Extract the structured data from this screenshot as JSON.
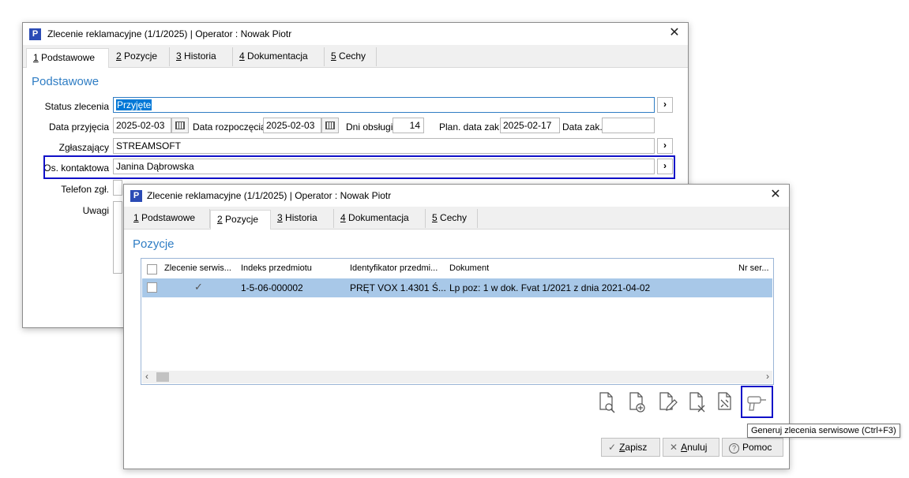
{
  "back_window": {
    "title": "Zlecenie reklamacyjne (1/1/2025)  |  Operator : Nowak Piotr",
    "app_icon_letter": "P",
    "close_glyph": "✕",
    "tabs": [
      {
        "key": "1",
        "label": " Podstawowe"
      },
      {
        "key": "2",
        "label": " Pozycje"
      },
      {
        "key": "3",
        "label": " Historia"
      },
      {
        "key": "4",
        "label": " Dokumentacja"
      },
      {
        "key": "5",
        "label": " Cechy"
      }
    ],
    "section_title": "Podstawowe",
    "labels": {
      "status": "Status zlecenia",
      "data_przyjecia": "Data przyjęcia",
      "data_rozpoczecia": "Data rozpoczęcia",
      "dni_obslugi": "Dni obsługi",
      "plan_data_zak": "Plan. data zak.",
      "data_zak": "Data zak.",
      "zglaszajacy": "Zgłaszający",
      "os_kontaktowa": "Os. kontaktowa",
      "telefon": "Telefon zgł.",
      "uwagi": "Uwagi"
    },
    "values": {
      "status": "Przyjęte",
      "data_przyjecia": "2025-02-03",
      "data_rozpoczecia": "2025-02-03",
      "dni_obslugi": "14",
      "plan_data_zak": "2025-02-17",
      "data_zak": "",
      "zglaszajacy": "STREAMSOFT",
      "os_kontaktowa": "Janina Dąbrowska"
    },
    "arrow_glyph": "›"
  },
  "front_window": {
    "title": "Zlecenie reklamacyjne (1/1/2025)  |  Operator : Nowak Piotr",
    "app_icon_letter": "P",
    "close_glyph": "✕",
    "tabs": [
      {
        "key": "1",
        "label": " Podstawowe"
      },
      {
        "key": "2",
        "label": " Pozycje"
      },
      {
        "key": "3",
        "label": " Historia"
      },
      {
        "key": "4",
        "label": " Dokumentacja"
      },
      {
        "key": "5",
        "label": " Cechy"
      }
    ],
    "section_title": "Pozycje",
    "grid": {
      "columns": [
        "Zlecenie serwis...",
        "Indeks przedmiotu",
        "Identyfikator przedmi...",
        "Dokument",
        "Nr ser..."
      ],
      "rows": [
        {
          "zlecenie": "✓",
          "indeks": "1-5-06-000002",
          "identyfikator": "PRĘT VOX 1.4301 Ś...",
          "dokument": "Lp poz: 1  w dok.  Fvat 1/2021    z dnia 2021-04-02",
          "nr_ser": ""
        }
      ],
      "scroll_left": "‹",
      "scroll_right": "›"
    },
    "toolbar_icons": [
      "document-preview-icon",
      "document-add-icon",
      "document-edit-icon",
      "document-delete-icon",
      "document-settings-icon",
      "drill-icon"
    ],
    "tooltip": "Generuj zlecenia serwisowe (Ctrl+F3)",
    "buttons": {
      "save_icon": "✓",
      "save_key": "Z",
      "save_label": "apisz",
      "cancel_icon": "✕",
      "cancel_key": "A",
      "cancel_label": "nuluj",
      "help_icon": "?",
      "help_label": "Pomoc"
    }
  }
}
